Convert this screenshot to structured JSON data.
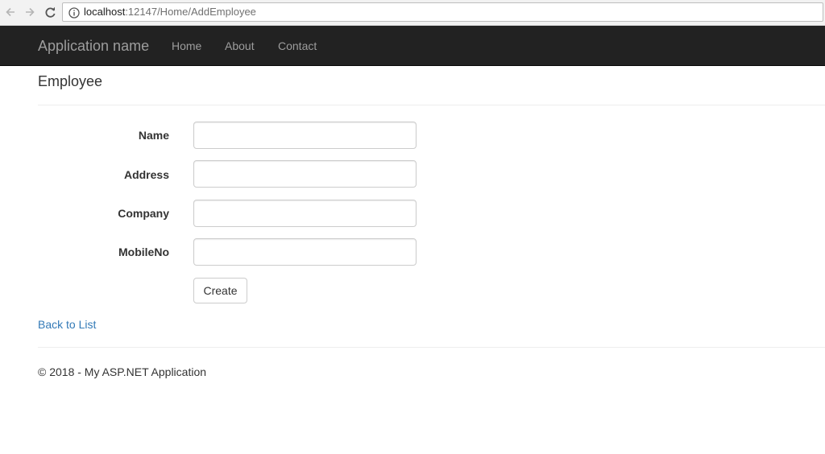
{
  "browser": {
    "url_host": "localhost",
    "url_path": ":12147/Home/AddEmployee"
  },
  "navbar": {
    "brand": "Application name",
    "links": [
      "Home",
      "About",
      "Contact"
    ],
    "background": "#222222",
    "link_color": "#9d9d9d"
  },
  "page": {
    "heading": "Employee"
  },
  "form": {
    "fields": [
      {
        "label": "Name",
        "value": ""
      },
      {
        "label": "Address",
        "value": ""
      },
      {
        "label": "Company",
        "value": ""
      },
      {
        "label": "MobileNo",
        "value": ""
      }
    ],
    "submit_label": "Create"
  },
  "back_link": "Back to List",
  "link_color": "#337ab7",
  "footer": {
    "text": "© 2018 - My ASP.NET Application"
  }
}
